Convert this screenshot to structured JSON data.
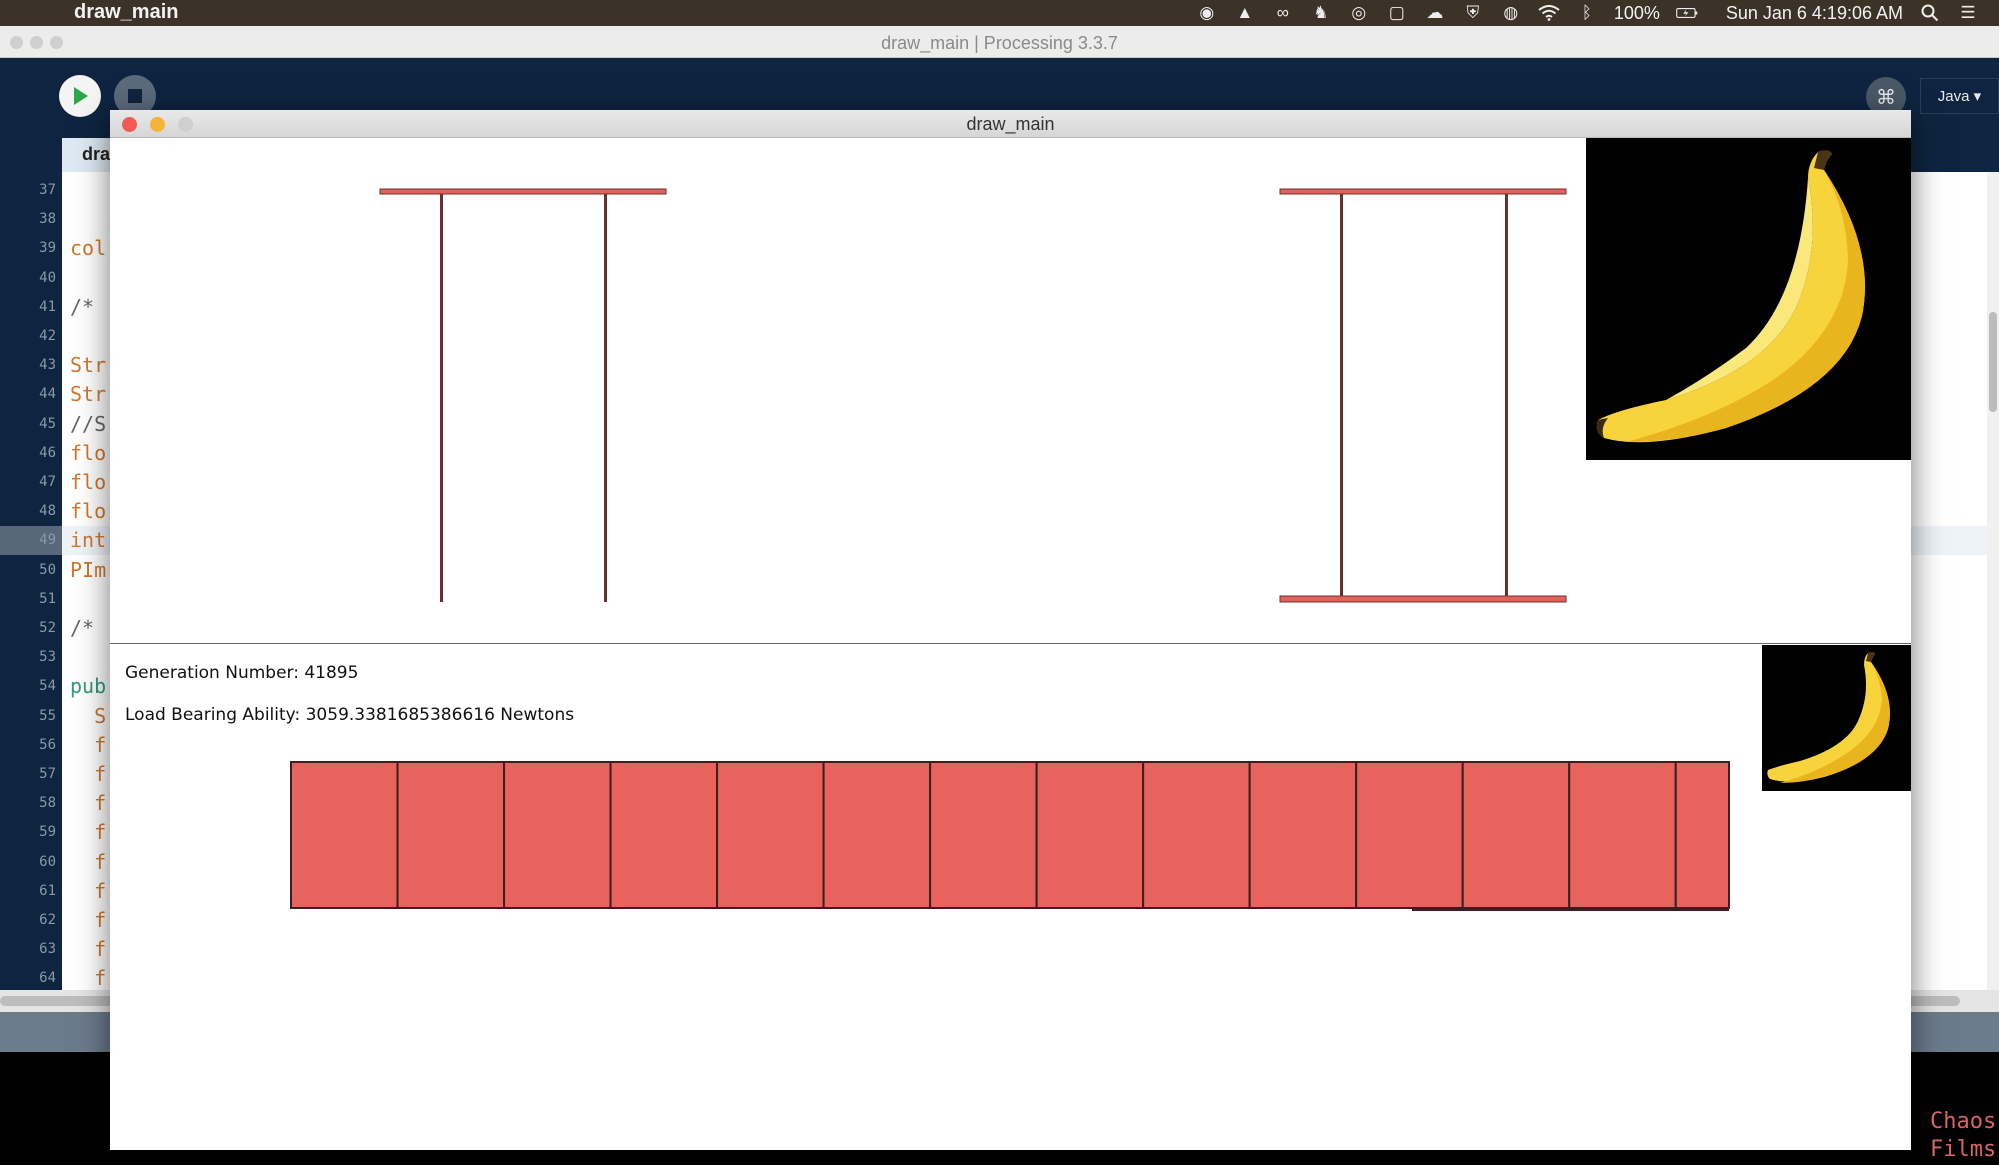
{
  "menubar": {
    "app_name": "draw_main",
    "battery": "100%",
    "clock": "Sun Jan 6  4:19:06 AM",
    "icons": [
      "record-icon",
      "vlc-icon",
      "creative-cloud-icon",
      "evernote-icon",
      "circle-icon",
      "square-icon",
      "cloud-icon",
      "shield-icon",
      "siri-icon",
      "wifi-icon",
      "bluetooth-icon",
      "battery-icon",
      "spotlight-icon",
      "menu-list-icon"
    ]
  },
  "ide": {
    "window_title": "draw_main | Processing 3.3.7",
    "mode_label": "Java ▾",
    "tab_label": "dra",
    "line_numbers": [
      "37",
      "38",
      "39",
      "40",
      "41",
      "42",
      "43",
      "44",
      "45",
      "46",
      "47",
      "48",
      "49",
      "50",
      "51",
      "52",
      "53",
      "54",
      "55",
      "56",
      "57",
      "58",
      "59",
      "60",
      "61",
      "62",
      "63",
      "64"
    ],
    "active_line": "49",
    "code_lines": [
      "",
      "",
      "col",
      "",
      "/*",
      "",
      "Str",
      "Str",
      "//S",
      "flo",
      "flo",
      "flo",
      "int",
      "PIm",
      "",
      "/*",
      "",
      "pub",
      "  S",
      "  f",
      "  f",
      "  f",
      "  f",
      "  f",
      "  f",
      "  f",
      "  f",
      "  f"
    ]
  },
  "sketch": {
    "window_title": "draw_main",
    "generation_label": "Generation Number: 41895",
    "load_label": "Load Bearing Ability: 3059.3381685386616 Newtons",
    "truss_segment_count": 14,
    "colors": {
      "beam_fill": "#e0625c",
      "beam_stroke": "#6b2f2d",
      "block_fill": "#e8625e",
      "block_stroke": "#3a2020",
      "banana_yellow": "#f7d33c"
    }
  },
  "watermark": {
    "line1": "Chaos",
    "line2": "Films"
  }
}
